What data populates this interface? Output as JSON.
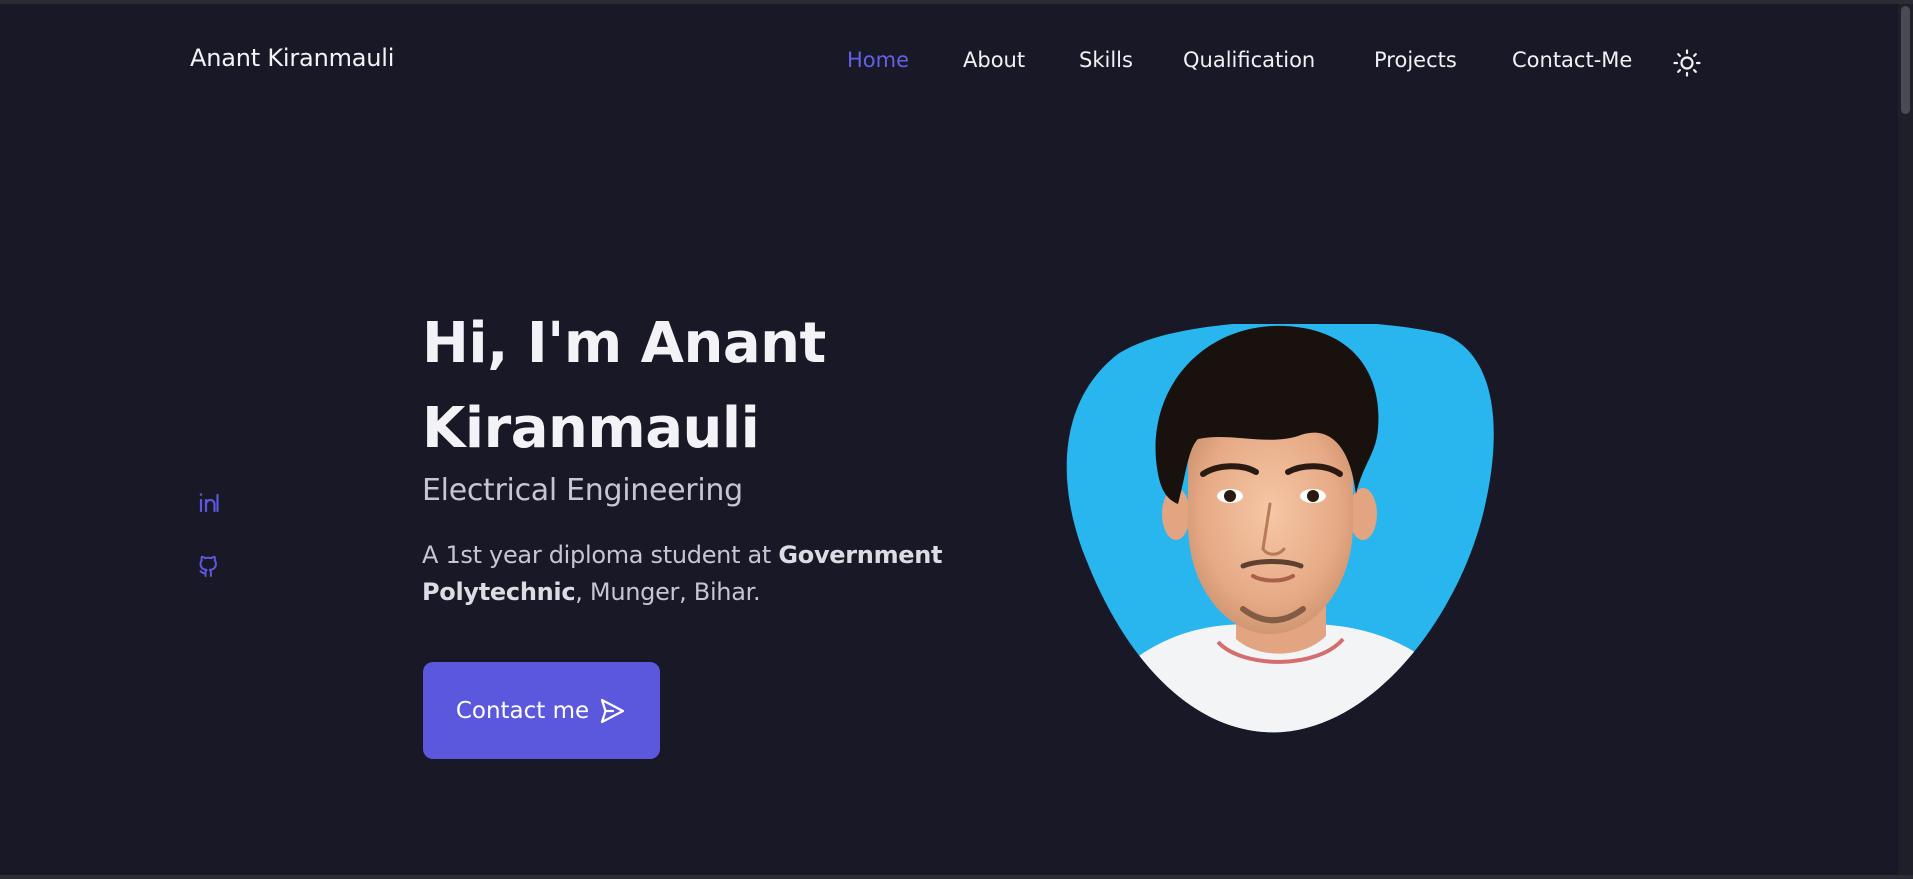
{
  "header": {
    "logo": "Anant Kiranmauli",
    "nav": [
      {
        "label": "Home",
        "active": true
      },
      {
        "label": "About",
        "active": false
      },
      {
        "label": "Skills",
        "active": false
      },
      {
        "label": "Qualification",
        "active": false
      },
      {
        "label": "Projects",
        "active": false
      },
      {
        "label": "Contact-Me",
        "active": false
      }
    ],
    "theme_icon": "sun-icon"
  },
  "social": [
    {
      "icon": "linkedin-icon"
    },
    {
      "icon": "github-icon"
    }
  ],
  "hero": {
    "title": "Hi, I'm Anant Kiranmauli",
    "subtitle": "Electrical Engineering",
    "description": {
      "prefix": "A 1st year diploma student at ",
      "bold": "Government Polytechnic",
      "suffix": ", Munger, Bihar."
    },
    "button_label": "Contact me",
    "button_icon": "send-icon"
  },
  "photo": {
    "subject": "profile-photo"
  },
  "colors": {
    "background": "#181826",
    "accent": "#5b58de",
    "nav_active": "#6360e6",
    "text": "#f3f3f7",
    "text_muted": "#c6c6d2",
    "photo_bg": "#23b1ec"
  }
}
